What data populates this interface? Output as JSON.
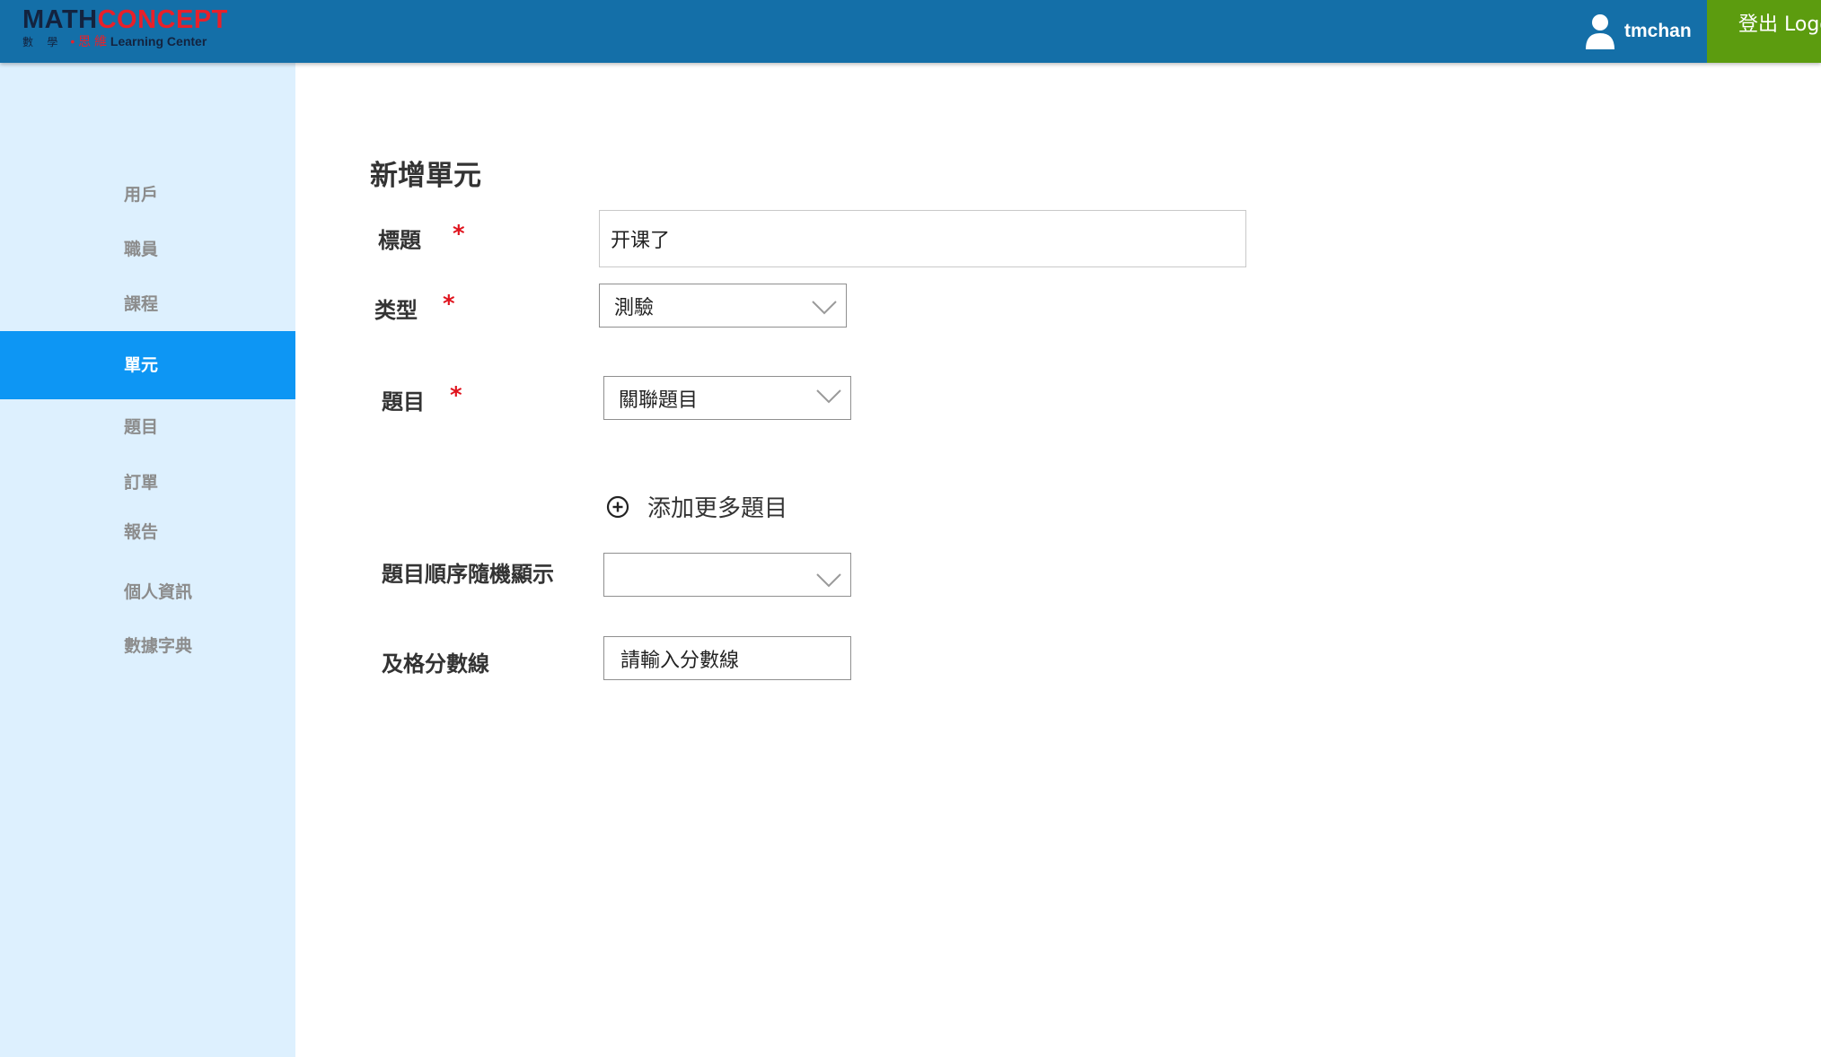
{
  "header": {
    "logo_math": "MATH",
    "logo_concept": "CONCEPT",
    "logo_sub_cn": "數 學",
    "logo_sub_dot": "• 思 維",
    "logo_sub_en": "Learning Center",
    "username": "tmchan",
    "logout_label": "登出 Logout"
  },
  "sidebar": {
    "items": [
      {
        "label": "用戶",
        "active": false
      },
      {
        "label": "職員",
        "active": false
      },
      {
        "label": "課程",
        "active": false
      },
      {
        "label": "單元",
        "active": true
      },
      {
        "label": "題目",
        "active": false
      },
      {
        "label": "訂單",
        "active": false
      },
      {
        "label": "報告",
        "active": false
      },
      {
        "label": "個人資訊",
        "active": false
      },
      {
        "label": "數據字典",
        "active": false
      }
    ]
  },
  "form": {
    "title": "新增單元",
    "required_mark": "*",
    "fields": {
      "title": {
        "label": "標題",
        "value": "开课了"
      },
      "type": {
        "label": "类型",
        "value": "測驗"
      },
      "questions": {
        "label": "題目",
        "placeholder": "關聯題目",
        "add_more": "添加更多題目"
      },
      "random_order": {
        "label": "題目順序隨機顯示",
        "value": ""
      },
      "pass_score": {
        "label": "及格分數線",
        "placeholder": "請輸入分數線"
      }
    }
  },
  "colors": {
    "header_bg": "#146fa8",
    "logout_bg": "#5c9c0f",
    "sidebar_bg": "#ddf0fe",
    "active_item_bg": "#0d96f4",
    "required": "#e0141e"
  }
}
